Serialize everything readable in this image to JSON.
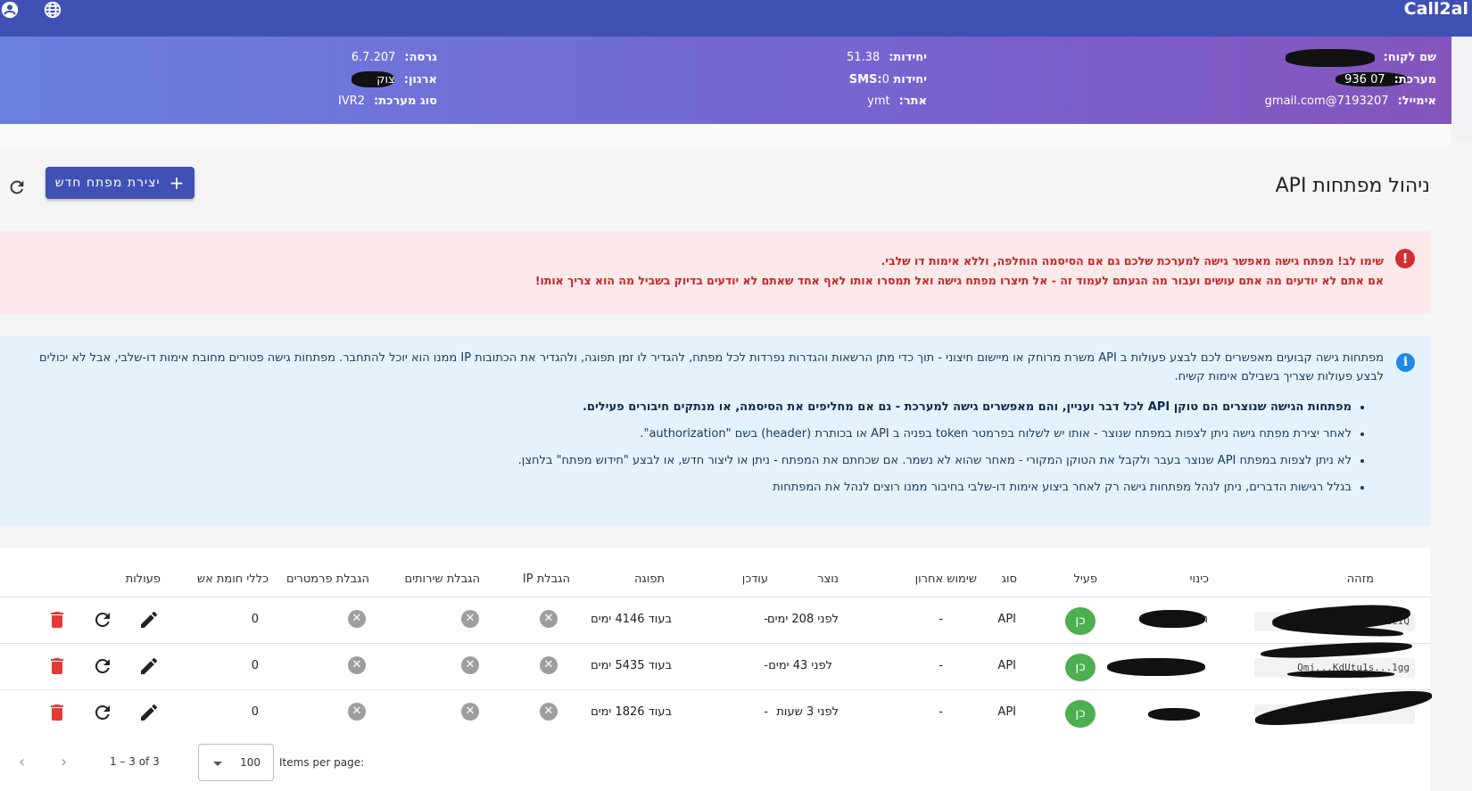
{
  "app": {
    "brand": "Call2al"
  },
  "topbar": {
    "account_icon": "account-circle-icon",
    "language_icon": "globe-icon"
  },
  "account": {
    "customer_label": "שם לקוח:",
    "system_label": "מערכת:",
    "system_value": "07 936",
    "email_label": "אימייל:",
    "email_value": "gmail.com@7193207",
    "units_label": "יחידות:",
    "units_value": "51.38",
    "sms_label": "יחידות SMS:",
    "sms_value": "0",
    "site_label": "אתר:",
    "site_value": "ymt",
    "version_label": "גרסה:",
    "version_value": "6.7.207",
    "org_label": "ארגון:",
    "org_value": "צוק",
    "systype_label": "סוג מערכת:",
    "systype_value": "IVR2"
  },
  "page": {
    "title": "ניהול מפתחות API",
    "new_key_button": "יצירת מפתח חדש",
    "refresh_icon": "refresh-icon"
  },
  "warning": {
    "line1": "שימו לב! מפתח גישה מאפשר גישה למערכת שלכם גם אם הסיסמה הוחלפה, וללא אימות דו שלבי.",
    "line2": "אם אתם לא יודעים מה אתם עושים ועבור מה הגעתם לעמוד זה - אל תיצרו מפתח גישה ואל תמסרו אותו לאף אחד שאתם לא יודעים בדיוק בשביל מה הוא צריך אותו!",
    "icon": "error-icon",
    "color": "#c62828"
  },
  "info": {
    "icon": "info-icon",
    "intro": "מפתחות גישה קבועים מאפשרים לכם לבצע פעולות ב API משרת מרוחק או מיישום חיצוני - תוך כדי מתן הרשאות והגדרות נפרדות לכל מפתח, להגדיר לו זמן תפוגה, ולהגדיר את הכתובות IP ממנו הוא יוכל להתחבר. מפתחות גישה פטורים מחובת אימות דו-שלבי, אבל לא יכולים לבצע פעולות שצריך בשבילם אימות קשיח.",
    "bullets": [
      "מפתחות הגישה שנוצרים הם טוקן API לכל דבר ועניין, והם מאפשרים גישה למערכת - גם אם מחליפים את הסיסמה, או מנתקים חיבורים פעילים.",
      "לאחר יצירת מפתח גישה ניתן לצפות במפתח שנוצר - אותו יש לשלוח בפרמטר token בפניה ב API או בכותרת (header) בשם \"authorization\".",
      "לא ניתן לצפות במפתח API שנוצר בעבר ולקבל את הטוקן המקורי - מאחר שהוא לא נשמר. אם שכחתם את המפתח - ניתן או ליצור חדש, או לבצע \"חידוש מפתח\" בלחצן.",
      "בגלל רגישות הדברים, ניתן לנהל מפתחות גישה רק לאחר ביצוע אימות דו-שלבי בחיבור ממנו רוצים לנהל את המפתחות"
    ]
  },
  "table": {
    "headers": {
      "id": "מזהה",
      "nickname": "כינוי",
      "active": "פעיל",
      "type": "סוג",
      "last_used": "שימוש אחרון",
      "created": "נוצר",
      "updated": "עודכן",
      "expires": "תפוגה",
      "ip_limit": "הגבלת IP",
      "service_limit": "הגבלת שירותים",
      "param_limit": "הגבלת פרמטרים",
      "firewall": "כללי חומת אש",
      "actions": "פעולות"
    },
    "rows": [
      {
        "id": "2yj...b8SBgXCKxm1NzcIQ",
        "nickname": "n",
        "active": "כן",
        "type": "API",
        "last_used": "-",
        "created": "לפני 208 ימים",
        "updated": "-",
        "expires": "בעוד 4146 ימים",
        "firewall": "0"
      },
      {
        "id": "Qmj...KdUtu1s...1gg",
        "nickname": "",
        "active": "כן",
        "type": "API",
        "last_used": "-",
        "created": "לפני 43 ימים",
        "updated": "-",
        "expires": "בעוד 5435 ימים",
        "firewall": "0"
      },
      {
        "id": "",
        "nickname": "",
        "active": "כן",
        "type": "API",
        "last_used": "-",
        "created": "לפני 3 שעות",
        "updated": "-",
        "expires": "בעוד 1826 ימים",
        "firewall": "0"
      }
    ]
  },
  "paginator": {
    "items_per_page_label": "Items per page:",
    "page_size": "100",
    "range": "1 – 3 of 3"
  },
  "colors": {
    "primary": "#3f51b5",
    "success": "#4caf50",
    "danger": "#e53935"
  }
}
